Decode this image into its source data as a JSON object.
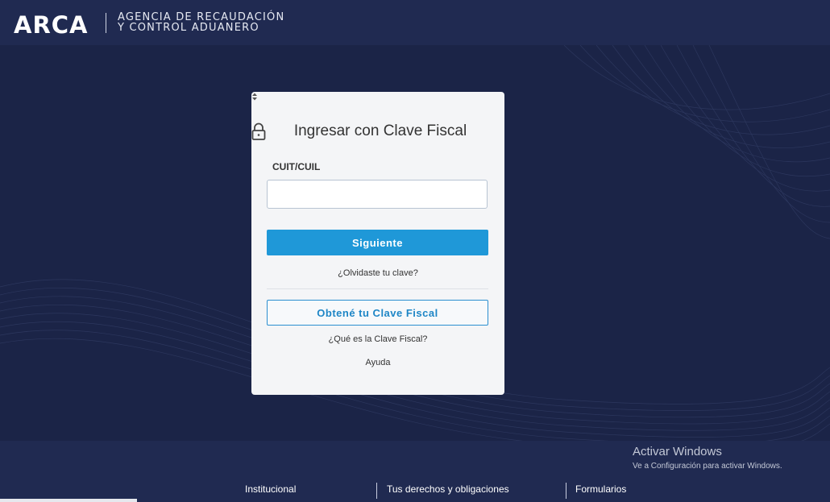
{
  "header": {
    "logo": "ARCA",
    "agency_line1": "AGENCIA DE RECAUDACIÓN",
    "agency_line2": "Y CONTROL ADUANERO"
  },
  "login": {
    "title": "Ingresar con Clave Fiscal",
    "title_icon": "lock-icon",
    "cuit_label": "CUIT/CUIL",
    "cuit_value": "",
    "next_button": "Siguiente",
    "forgot_link": "¿Olvidaste tu clave?",
    "get_key_button": "Obtené tu Clave Fiscal",
    "what_is_link": "¿Qué es la Clave Fiscal?",
    "help_link": "Ayuda"
  },
  "footer": {
    "links": [
      "Institucional",
      "Tus derechos y obligaciones",
      "Formularios"
    ]
  },
  "watermark": {
    "line1": "Activar Windows",
    "line2": "Ve a Configuración para activar Windows."
  },
  "colors": {
    "header_bg": "#202a51",
    "page_bg": "#1b2447",
    "primary": "#1f98d8"
  }
}
